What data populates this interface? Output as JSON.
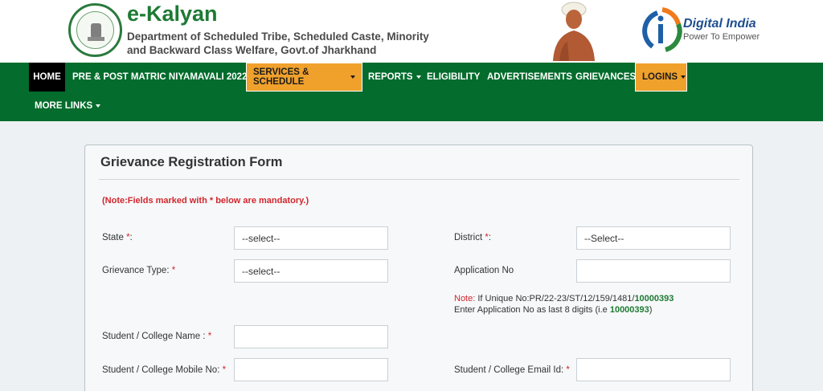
{
  "header": {
    "brand_title": "e-Kalyan",
    "brand_subtitle": "Department of Scheduled Tribe, Scheduled Caste, Minority and Backward Class Welfare, Govt.of Jharkhand",
    "digital_india_title": "Digital India",
    "digital_india_tagline": "Power To Empower"
  },
  "nav": {
    "items": [
      {
        "label": "HOME"
      },
      {
        "label": "PRE & POST MATRIC NIYAMAVALI 2022"
      },
      {
        "label": "SERVICES & SCHEDULE"
      },
      {
        "label": "REPORTS"
      },
      {
        "label": "ELIGIBILITY"
      },
      {
        "label": "ADVERTISEMENTS"
      },
      {
        "label": "GRIEVANCES"
      },
      {
        "label": "LOGINS"
      },
      {
        "label": "MORE LINKS"
      }
    ]
  },
  "form": {
    "title": "Grievance Registration Form",
    "note": "(Note:Fields marked with * below are mandatory.)",
    "required_mark": "*",
    "fields": {
      "state": {
        "label": "State",
        "suffix": ":",
        "value": "--select--"
      },
      "district": {
        "label": "District",
        "suffix": ":",
        "value": "--Select--"
      },
      "grievance_type": {
        "label": "Grievance Type:",
        "value": "--select--"
      },
      "application_no": {
        "label": "Application No",
        "value": ""
      },
      "student_name": {
        "label": "Student / College Name :",
        "value": ""
      },
      "student_mobile": {
        "label": "Student / College Mobile No:",
        "value": ""
      },
      "student_email": {
        "label": "Student / College Email Id:",
        "value": ""
      }
    },
    "hint": {
      "note_word": "Note:",
      "line1_prefix": "If Unique No:PR/22-23/ST/12/159/1481/",
      "line1_number": "10000393",
      "line2_prefix": "Enter Application No as last 8 digits (i.e",
      "line2_number": "10000393",
      "line2_suffix": ")"
    }
  },
  "colors": {
    "nav_bg": "#046c2c",
    "highlight": "#f0a12c",
    "brand_green": "#1e7a34",
    "required_red": "#d2262d"
  }
}
